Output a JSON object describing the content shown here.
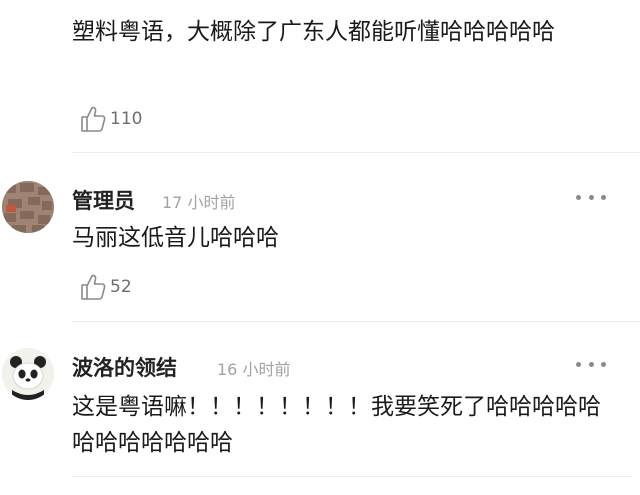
{
  "comments": [
    {
      "text": "塑料粤语，大概除了广东人都能听懂哈哈哈哈哈",
      "likes": "110"
    },
    {
      "username": "管理员",
      "time": "17 小时前",
      "text": "马丽这低音儿哈哈哈",
      "likes": "52"
    },
    {
      "username": "波洛的领结",
      "time": "16 小时前",
      "text": "这是粤语嘛！！！！！！！！我要笑死了哈哈哈哈哈哈哈哈哈哈哈哈"
    }
  ],
  "icons": {
    "like": "thumbs-up-icon",
    "more": "more-dots-icon"
  },
  "colors": {
    "text": "#1a1a1a",
    "muted": "#a3a3a3",
    "icon": "#8a8a8a"
  }
}
